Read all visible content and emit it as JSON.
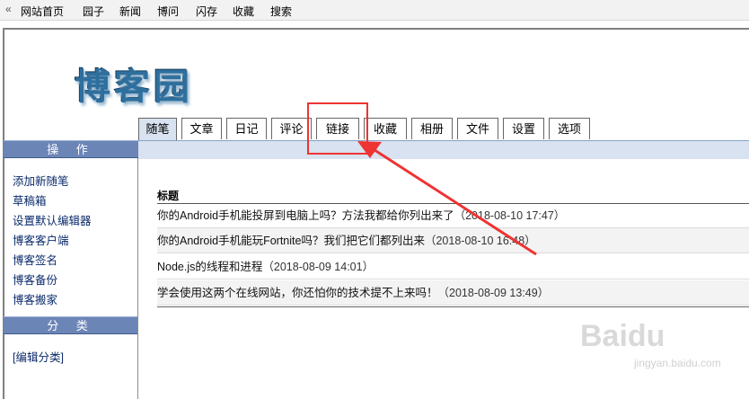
{
  "topnav": {
    "items": [
      "网站首页",
      "园子",
      "新闻",
      "博问",
      "闪存",
      "收藏",
      "搜索"
    ]
  },
  "logo": {
    "text": "博客园"
  },
  "tabs": [
    "随笔",
    "文章",
    "日记",
    "评论",
    "链接",
    "收藏",
    "相册",
    "文件",
    "设置",
    "选项"
  ],
  "active_tab": "随笔",
  "sidebar": {
    "section1_title": "操 作",
    "links": [
      "添加新随笔",
      "草稿箱",
      "设置默认编辑器",
      "博客客户端",
      "博客签名",
      "博客备份",
      "博客搬家"
    ],
    "section2_title": "分 类",
    "category_link": "[编辑分类]"
  },
  "table": {
    "header": "标题",
    "rows": [
      {
        "title": "你的Android手机能投屏到电脑上吗？方法我都给你列出来了",
        "date": "（2018-08-10 17:47）"
      },
      {
        "title": "你的Android手机能玩Fortnite吗？我们把它们都列出来",
        "date": "（2018-08-10 16:48）"
      },
      {
        "title": "Node.js的线程和进程",
        "date": "（2018-08-09 14:01）"
      },
      {
        "title": "学会使用这两个在线网站，你还怕你的技术提不上来吗！",
        "date": "（2018-08-09 13:49）"
      }
    ]
  },
  "watermark": {
    "brand": "Baidu",
    "sub": "jingyan.baidu.com"
  },
  "colors": {
    "tab_bar": "#d8e2f0",
    "sidebar_header": "#6c85b7",
    "annotation": "#e33333"
  }
}
